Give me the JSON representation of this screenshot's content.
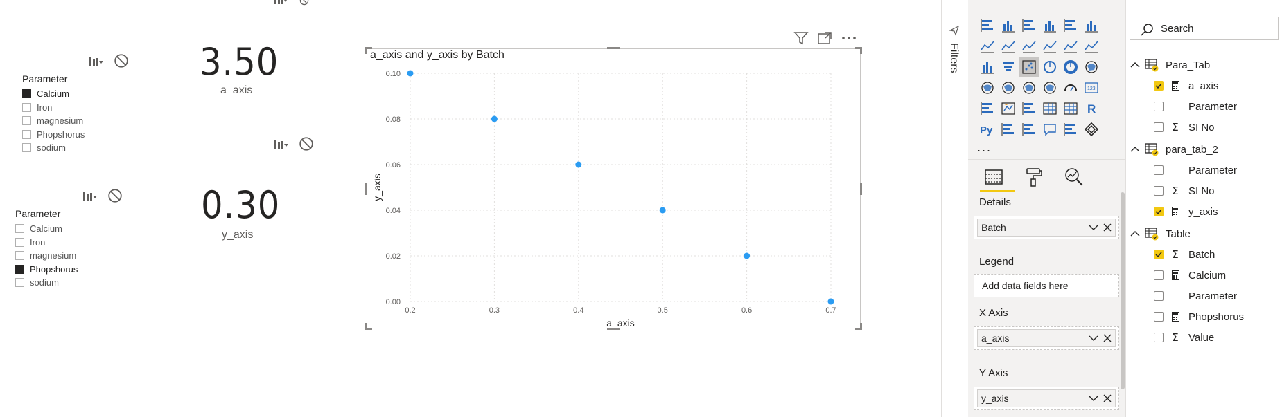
{
  "canvas": {
    "slicer_top": {
      "title": "Parameter",
      "items": [
        {
          "label": "Calcium",
          "checked": true
        },
        {
          "label": "Iron",
          "checked": false
        },
        {
          "label": "magnesium",
          "checked": false
        },
        {
          "label": "Phopshorus",
          "checked": false
        },
        {
          "label": "sodium",
          "checked": false
        }
      ]
    },
    "slicer_bottom": {
      "title": "Parameter",
      "items": [
        {
          "label": "Calcium",
          "checked": false
        },
        {
          "label": "Iron",
          "checked": false
        },
        {
          "label": "magnesium",
          "checked": false
        },
        {
          "label": "Phopshorus",
          "checked": true
        },
        {
          "label": "sodium",
          "checked": false
        }
      ]
    },
    "card_a": {
      "value": "3.50",
      "label": "a_axis"
    },
    "card_y": {
      "value": "0.30",
      "label": "y_axis"
    },
    "visual": {
      "title": "a_axis and y_axis by Batch"
    }
  },
  "chart_data": {
    "type": "scatter",
    "title": "a_axis and y_axis by Batch",
    "xlabel": "a_axis",
    "ylabel": "y_axis",
    "x_ticks": [
      "0.2",
      "0.3",
      "0.4",
      "0.5",
      "0.6",
      "0.7"
    ],
    "y_ticks": [
      "0.00",
      "0.02",
      "0.04",
      "0.06",
      "0.08",
      "0.10"
    ],
    "xlim": [
      0.2,
      0.7
    ],
    "ylim": [
      0.0,
      0.1
    ],
    "grid": true,
    "points": [
      {
        "x": 0.2,
        "y": 0.1
      },
      {
        "x": 0.3,
        "y": 0.08
      },
      {
        "x": 0.4,
        "y": 0.06
      },
      {
        "x": 0.5,
        "y": 0.04
      },
      {
        "x": 0.6,
        "y": 0.02
      },
      {
        "x": 0.7,
        "y": 0.0
      }
    ],
    "colors": {
      "marker": "#2b9cf2",
      "grid": "#e1dfdd",
      "axis_text": "#605e5c"
    }
  },
  "filters": {
    "label": "Filters"
  },
  "visualizations": {
    "more": "...",
    "wells": {
      "details": {
        "label": "Details",
        "field": "Batch"
      },
      "legend": {
        "label": "Legend",
        "placeholder": "Add data fields here"
      },
      "x_axis": {
        "label": "X Axis",
        "field": "a_axis"
      },
      "y_axis": {
        "label": "Y Axis",
        "field": "y_axis"
      }
    }
  },
  "fields": {
    "search_placeholder": "Search",
    "tables": [
      {
        "name": "Para_Tab",
        "fields": [
          {
            "name": "a_axis",
            "checked": true,
            "icon": "calc-icon"
          },
          {
            "name": "Parameter",
            "checked": false,
            "icon": ""
          },
          {
            "name": "SI No",
            "checked": false,
            "icon": "sigma-icon"
          }
        ]
      },
      {
        "name": "para_tab_2",
        "fields": [
          {
            "name": "Parameter",
            "checked": false,
            "icon": ""
          },
          {
            "name": "SI No",
            "checked": false,
            "icon": "sigma-icon"
          },
          {
            "name": "y_axis",
            "checked": true,
            "icon": "calc-icon"
          }
        ]
      },
      {
        "name": "Table",
        "fields": [
          {
            "name": "Batch",
            "checked": true,
            "icon": "sigma-icon"
          },
          {
            "name": "Calcium",
            "checked": false,
            "icon": "calc-icon"
          },
          {
            "name": "Parameter",
            "checked": false,
            "icon": ""
          },
          {
            "name": "Phopshorus",
            "checked": false,
            "icon": "calc-icon"
          },
          {
            "name": "Value",
            "checked": false,
            "icon": "sigma-icon"
          }
        ]
      }
    ]
  },
  "accent": "#f2c811"
}
